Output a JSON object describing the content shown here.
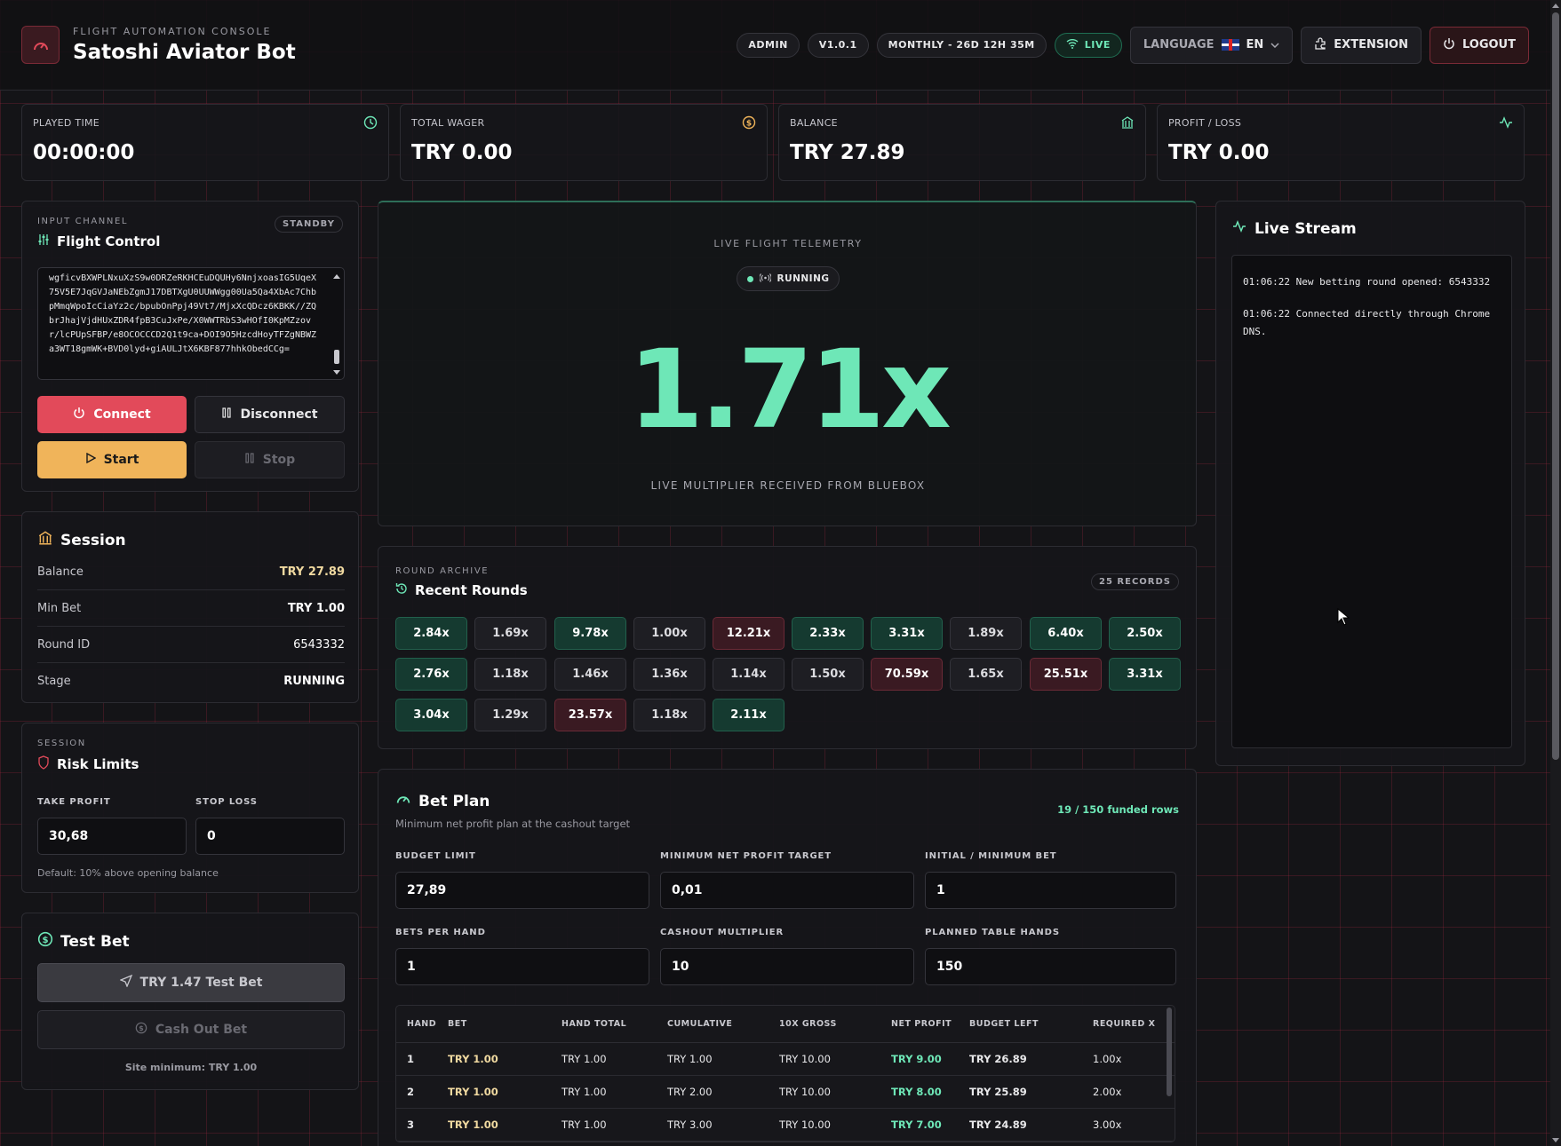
{
  "header": {
    "subtitle": "FLIGHT AUTOMATION CONSOLE",
    "title": "Satoshi Aviator Bot",
    "pills": {
      "role": "ADMIN",
      "version": "V1.0.1",
      "plan": "MONTHLY - 26D 12H 35M",
      "live": "LIVE"
    },
    "language_label": "LANGUAGE",
    "language_code": "EN",
    "extension_label": "EXTENSION",
    "logout_label": "LOGOUT"
  },
  "stats": [
    {
      "label": "PLAYED TIME",
      "value": "00:00:00",
      "icon": "clock-icon"
    },
    {
      "label": "TOTAL WAGER",
      "value": "TRY 0.00",
      "icon": "coin-icon"
    },
    {
      "label": "BALANCE",
      "value": "TRY 27.89",
      "icon": "bank-icon"
    },
    {
      "label": "PROFIT / LOSS",
      "value": "TRY 0.00",
      "icon": "activity-icon"
    }
  ],
  "flight_control": {
    "kicker": "INPUT CHANNEL",
    "title": "Flight Control",
    "status": "STANDBY",
    "token": "wgficvBXWPLNxuXzS9w0DRZeRKHCEuDQUHy6NnjxoasIG5UqeX75V5E7JqGVJaNEbZgmJ17DBTXgU0UUWWgg00Ua5Qa4XbAc7ChbpMmqWpoIcCiaYz2c/bpubOnPpj49Vt7/MjxXcQDcz6KBKK//ZQbrJhajVjdHUxZDR4fpB3CuJxPe/X0WWTRbS3wHOfI0KpMZzovr/lcPUpSFBP/e8OCOCCCD2Q1t9ca+DOI9O5HzcdHoyTFZgNBWZa3WT18gmWK+BVD0lyd+giAULJtX6KBF877hhkObedCCg=",
    "connect": "Connect",
    "disconnect": "Disconnect",
    "start": "Start",
    "stop": "Stop"
  },
  "session": {
    "title": "Session",
    "rows": [
      {
        "label": "Balance",
        "value": "TRY 27.89"
      },
      {
        "label": "Min Bet",
        "value": "TRY 1.00"
      },
      {
        "label": "Round ID",
        "value": "6543332"
      },
      {
        "label": "Stage",
        "value": "RUNNING"
      }
    ]
  },
  "risk": {
    "kicker": "SESSION",
    "title": "Risk Limits",
    "take_profit_label": "TAKE PROFIT",
    "take_profit": "30,68",
    "stop_loss_label": "STOP LOSS",
    "stop_loss": "0",
    "hint": "Default: 10% above opening balance"
  },
  "test_bet": {
    "title": "Test Bet",
    "bet_button": "TRY 1.47 Test Bet",
    "cashout_button": "Cash Out Bet",
    "minimum": "Site minimum: TRY 1.00"
  },
  "telemetry": {
    "kicker": "LIVE FLIGHT TELEMETRY",
    "status": "RUNNING",
    "multiplier": "1.71x",
    "caption": "LIVE MULTIPLIER RECEIVED FROM BLUEBOX"
  },
  "rounds": {
    "kicker": "ROUND ARCHIVE",
    "title": "Recent Rounds",
    "badge": "25 RECORDS",
    "items": [
      {
        "v": "2.84x",
        "t": "g"
      },
      {
        "v": "1.69x",
        "t": "n"
      },
      {
        "v": "9.78x",
        "t": "g"
      },
      {
        "v": "1.00x",
        "t": "n"
      },
      {
        "v": "12.21x",
        "t": "r"
      },
      {
        "v": "2.33x",
        "t": "g"
      },
      {
        "v": "3.31x",
        "t": "g"
      },
      {
        "v": "1.89x",
        "t": "n"
      },
      {
        "v": "6.40x",
        "t": "g"
      },
      {
        "v": "2.50x",
        "t": "g"
      },
      {
        "v": "2.76x",
        "t": "g"
      },
      {
        "v": "1.18x",
        "t": "n"
      },
      {
        "v": "1.46x",
        "t": "n"
      },
      {
        "v": "1.36x",
        "t": "n"
      },
      {
        "v": "1.14x",
        "t": "n"
      },
      {
        "v": "1.50x",
        "t": "n"
      },
      {
        "v": "70.59x",
        "t": "r"
      },
      {
        "v": "1.65x",
        "t": "n"
      },
      {
        "v": "25.51x",
        "t": "r"
      },
      {
        "v": "3.31x",
        "t": "g"
      },
      {
        "v": "3.04x",
        "t": "g"
      },
      {
        "v": "1.29x",
        "t": "n"
      },
      {
        "v": "23.57x",
        "t": "r"
      },
      {
        "v": "1.18x",
        "t": "n"
      },
      {
        "v": "2.11x",
        "t": "g"
      }
    ]
  },
  "bet_plan": {
    "title": "Bet Plan",
    "subtitle": "Minimum net profit plan at the cashout target",
    "funded": "19 / 150 funded rows",
    "budget_label": "BUDGET LIMIT",
    "budget": "27,89",
    "min_profit_label": "MINIMUM NET PROFIT TARGET",
    "min_profit": "0,01",
    "initial_bet_label": "INITIAL / MINIMUM BET",
    "initial_bet": "1",
    "bets_per_hand_label": "BETS PER HAND",
    "bets_per_hand": "1",
    "cashout_label": "CASHOUT MULTIPLIER",
    "cashout": "10",
    "table_hands_label": "PLANNED TABLE HANDS",
    "table_hands": "150",
    "columns": [
      "HAND",
      "BET",
      "HAND TOTAL",
      "CUMULATIVE",
      "10X GROSS",
      "NET PROFIT",
      "BUDGET LEFT",
      "REQUIRED X"
    ],
    "rows": [
      [
        "1",
        "TRY 1.00",
        "TRY 1.00",
        "TRY 1.00",
        "TRY 10.00",
        "TRY 9.00",
        "TRY 26.89",
        "1.00x"
      ],
      [
        "2",
        "TRY 1.00",
        "TRY 1.00",
        "TRY 2.00",
        "TRY 10.00",
        "TRY 8.00",
        "TRY 25.89",
        "2.00x"
      ],
      [
        "3",
        "TRY 1.00",
        "TRY 1.00",
        "TRY 3.00",
        "TRY 10.00",
        "TRY 7.00",
        "TRY 24.89",
        "3.00x"
      ]
    ]
  },
  "live_stream": {
    "title": "Live Stream",
    "lines": [
      "01:06:22 New betting round opened: 6543332",
      "01:06:22 Connected directly through Chrome DNS."
    ]
  },
  "colors": {
    "accent_green": "#6ee7b7",
    "accent_red": "#e24a5a",
    "accent_yellow": "#f0b45a",
    "background": "#141417"
  }
}
